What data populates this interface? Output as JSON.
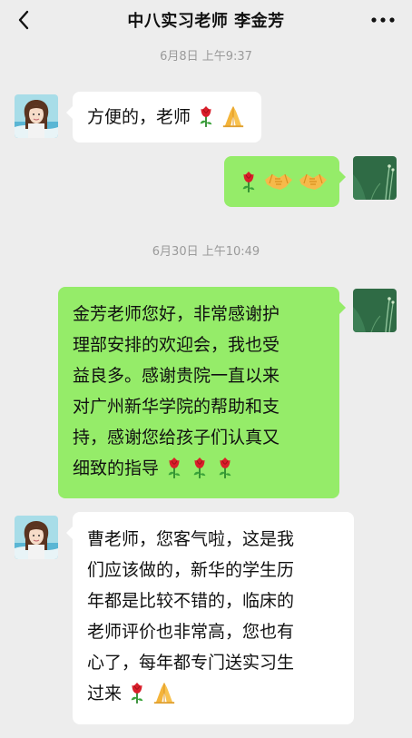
{
  "header": {
    "title": "中八实习老师 李金芳"
  },
  "timestamps": [
    "6月8日 上午9:37",
    "6月30日 上午10:49"
  ],
  "messages": [
    {
      "side": "left",
      "lines": [
        "方便的，老师"
      ],
      "emojis": [
        "rose-emoji",
        "folded-hands-emoji"
      ]
    },
    {
      "side": "right",
      "lines": [
        ""
      ],
      "emojis": [
        "rose-emoji",
        "handshake-emoji",
        "handshake-emoji"
      ]
    },
    {
      "side": "right",
      "lines": [
        "金芳老师您好，非常感谢护",
        "理部安排的欢迎会，我也受",
        "益良多。感谢贵院一直以来",
        "对广州新华学院的帮助和支",
        "持，感谢您给孩子们认真又",
        "细致的指导"
      ],
      "emojis": [
        "rose-emoji",
        "rose-emoji",
        "rose-emoji"
      ]
    },
    {
      "side": "left",
      "lines": [
        "曹老师，您客气啦，这是我",
        "们应该做的，新华的学生历",
        "年都是比较不错的，临床的",
        "老师评价也非常高，您也有",
        "心了，每年都专门送实习生",
        "过来"
      ],
      "emojis": [
        "rose-emoji",
        "folded-hands-emoji"
      ]
    }
  ],
  "colors": {
    "background": "#ededed",
    "bubble_self": "#95ec69",
    "bubble_other": "#ffffff",
    "timestamp_text": "#9a9a9a"
  }
}
